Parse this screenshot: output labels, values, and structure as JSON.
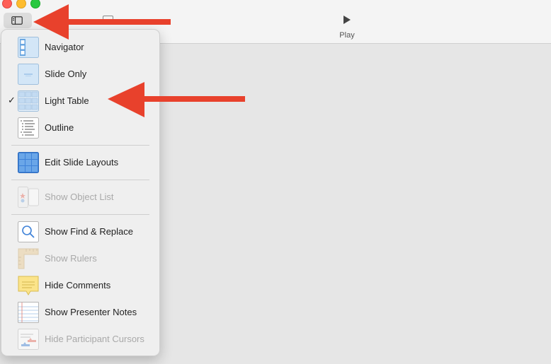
{
  "toolbar": {
    "play_label": "Play"
  },
  "menu": {
    "items": [
      {
        "label": "Navigator"
      },
      {
        "label": "Slide Only"
      },
      {
        "label": "Light Table",
        "checked": true
      },
      {
        "label": "Outline"
      },
      {
        "label": "Edit Slide Layouts"
      },
      {
        "label": "Show Object List",
        "disabled": true
      },
      {
        "label": "Show Find & Replace"
      },
      {
        "label": "Show Rulers",
        "disabled": true
      },
      {
        "label": "Hide Comments"
      },
      {
        "label": "Show Presenter Notes"
      },
      {
        "label": "Hide Participant Cursors",
        "disabled": true
      }
    ],
    "check_glyph": "✓"
  },
  "colors": {
    "arrow": "#e8412c",
    "accent": "#4a8fe7"
  }
}
